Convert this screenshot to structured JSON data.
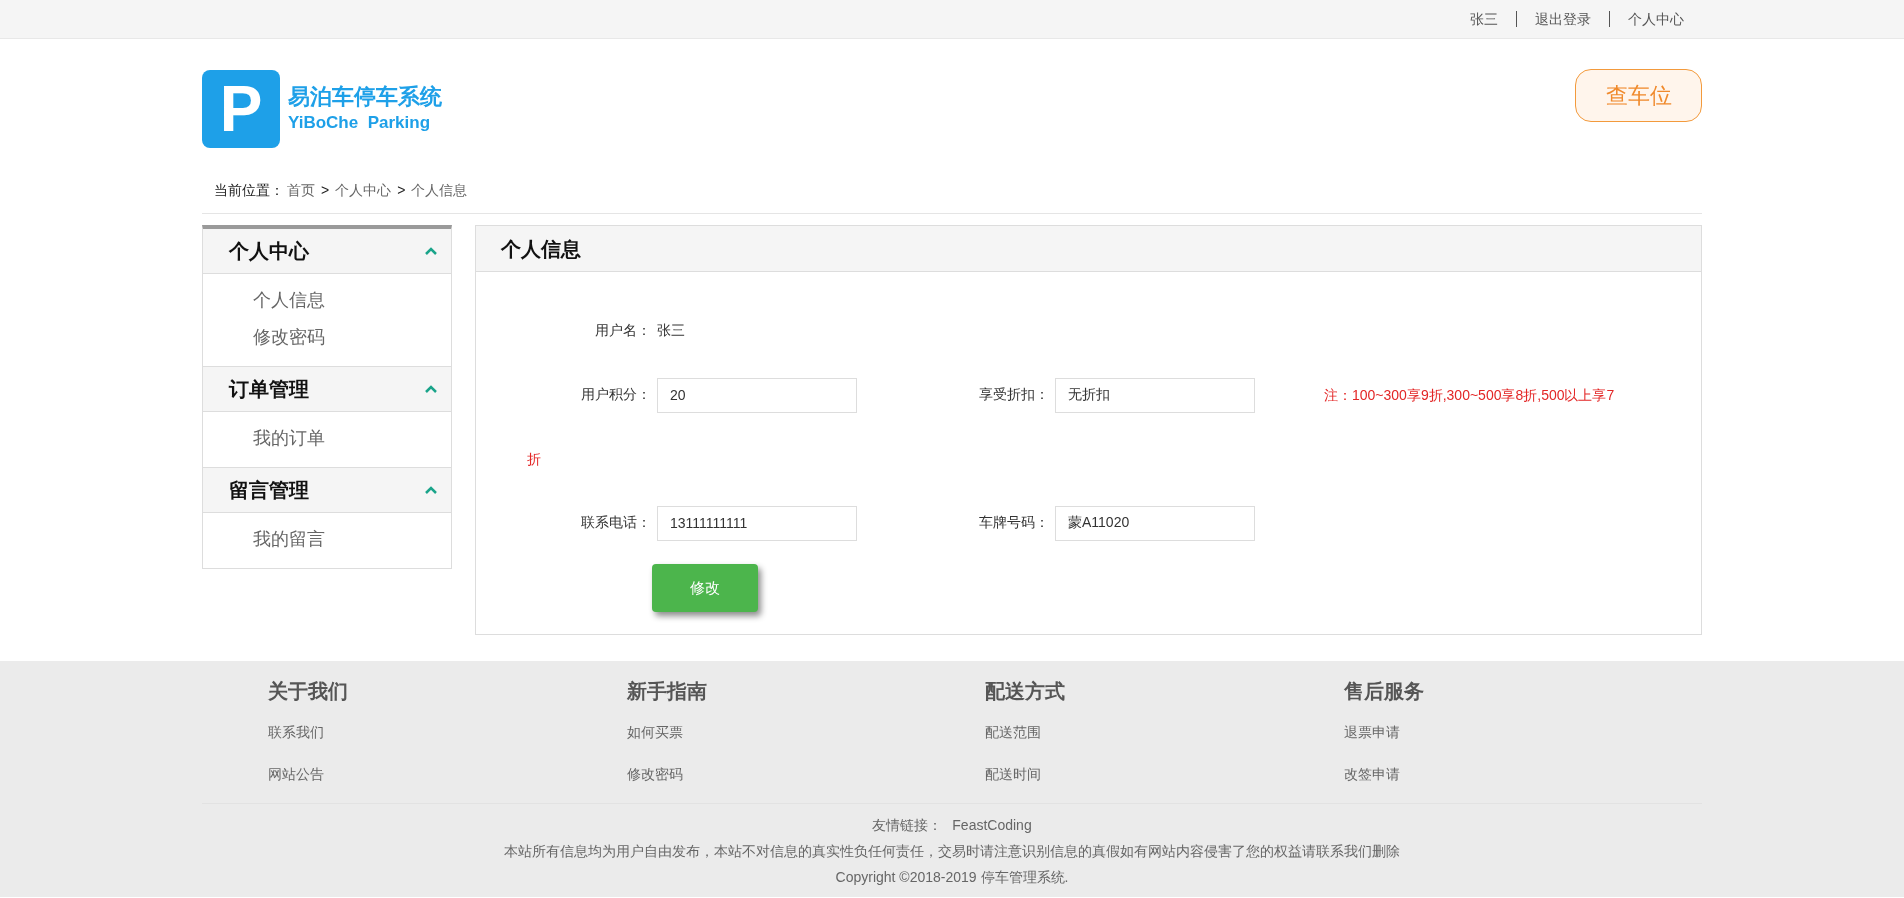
{
  "top_bar": {
    "links": [
      "张三",
      "退出登录",
      "个人中心"
    ]
  },
  "header": {
    "logo_mark": "P",
    "logo_title": "易泊车停车系统",
    "logo_subtitle": "YiBoChe  Parking",
    "action_button": "查车位"
  },
  "breadcrumb": {
    "label": "当前位置：",
    "items": [
      {
        "kind": "link",
        "text": "首页"
      },
      {
        "kind": "separator",
        "text": ">"
      },
      {
        "kind": "link",
        "text": "个人中心"
      },
      {
        "kind": "separator",
        "text": ">"
      },
      {
        "kind": "link",
        "text": "个人信息"
      }
    ]
  },
  "sidebar": {
    "groups": [
      {
        "title": "个人中心",
        "expanded": true,
        "items": [
          "个人信息",
          "修改密码"
        ]
      },
      {
        "title": "订单管理",
        "expanded": true,
        "items": [
          "我的订单"
        ]
      },
      {
        "title": "留言管理",
        "expanded": true,
        "items": [
          "我的留言"
        ]
      }
    ]
  },
  "panel": {
    "title": "个人信息",
    "rows": [
      {
        "fields": [
          {
            "kind": "text",
            "label": "用户名：",
            "value": "张三"
          }
        ]
      },
      {
        "fields": [
          {
            "kind": "input",
            "label": "用户积分：",
            "value": "20"
          },
          {
            "kind": "input",
            "label": "享受折扣：",
            "value": "无折扣"
          },
          {
            "kind": "note",
            "lines": [
              "注：100~300享9折,300~500享8折,500以上享7",
              "折"
            ]
          }
        ]
      },
      {
        "fields": [
          {
            "kind": "input",
            "label": "联系电话：",
            "value": "13111111111"
          },
          {
            "kind": "input",
            "label": "车牌号码：",
            "value": "蒙A11020"
          }
        ]
      }
    ],
    "submit_button": "修改"
  },
  "footer": {
    "columns": [
      {
        "title": "关于我们",
        "links": [
          "联系我们",
          "网站公告"
        ]
      },
      {
        "title": "新手指南",
        "links": [
          "如何买票",
          "修改密码"
        ]
      },
      {
        "title": "配送方式",
        "links": [
          "配送范围",
          "配送时间"
        ]
      },
      {
        "title": "售后服务",
        "links": [
          "退票申请",
          "改签申请"
        ]
      }
    ],
    "friend_links": {
      "label": "友情链接：",
      "links": [
        "FeastCoding"
      ]
    },
    "disclaimer": "本站所有信息均为用户自由发布，本站不对信息的真实性负任何责任，交易时请注意识别信息的真假如有网站内容侵害了您的权益请联系我们删除",
    "copyright": "Copyright ©2018-2019 停车管理系统."
  }
}
